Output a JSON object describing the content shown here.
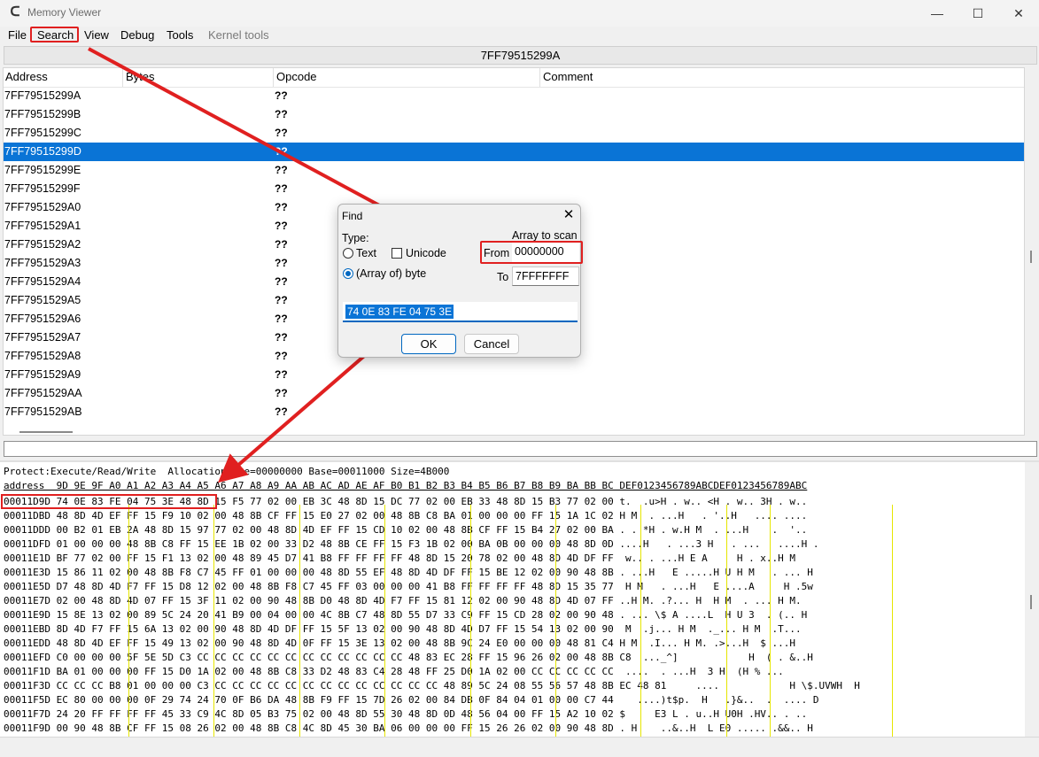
{
  "window": {
    "title": "Memory Viewer",
    "minimize": "—",
    "maximize": "☐",
    "close": "✕",
    "icon": "ce-icon"
  },
  "menu": {
    "items": [
      "File",
      "Search",
      "View",
      "Debug",
      "Tools"
    ],
    "disabled_item": "Kernel tools"
  },
  "address_bar": {
    "value": "7FF79515299A"
  },
  "disasm": {
    "columns": [
      "Address",
      "Bytes",
      "Opcode",
      "Comment"
    ],
    "rows": [
      {
        "address": "7FF79515299A",
        "opcode": "??"
      },
      {
        "address": "7FF79515299B",
        "opcode": "??"
      },
      {
        "address": "7FF79515299C",
        "opcode": "??"
      },
      {
        "address": "7FF79515299D",
        "opcode": "??"
      },
      {
        "address": "7FF79515299E",
        "opcode": "??"
      },
      {
        "address": "7FF79515299F",
        "opcode": "??"
      },
      {
        "address": "7FF7951529A0",
        "opcode": "??"
      },
      {
        "address": "7FF7951529A1",
        "opcode": "??"
      },
      {
        "address": "7FF7951529A2",
        "opcode": "??"
      },
      {
        "address": "7FF7951529A3",
        "opcode": "??"
      },
      {
        "address": "7FF7951529A4",
        "opcode": "??"
      },
      {
        "address": "7FF7951529A5",
        "opcode": "??"
      },
      {
        "address": "7FF7951529A6",
        "opcode": "??"
      },
      {
        "address": "7FF7951529A7",
        "opcode": "??"
      },
      {
        "address": "7FF7951529A8",
        "opcode": "??"
      },
      {
        "address": "7FF7951529A9",
        "opcode": "??"
      },
      {
        "address": "7FF7951529AA",
        "opcode": "??"
      },
      {
        "address": "7FF7951529AB",
        "opcode": "??"
      }
    ],
    "selected_index": 3
  },
  "hex": {
    "info": "Protect:Execute/Read/Write  AllocationBase=00000000 Base=00011000 Size=4B000",
    "header": "address  9D 9E 9F A0 A1 A2 A3 A4 A5 A6 A7 A8 A9 AA AB AC AD AE AF B0 B1 B2 B3 B4 B5 B6 B7 B8 B9 BA BB BC DEF0123456789ABCDEF0123456789ABC",
    "lines": [
      "00011D9D 74 0E 83 FE 04 75 3E 48 8D 15 F5 77 02 00 EB 3C 48 8D 15 DC 77 02 00 EB 33 48 8D 15 B3 77 02 00 t.  .u>H . w.. <H . w.. 3H . w..",
      "00011DBD 48 8D 4D EF FF 15 F9 10 02 00 48 8B CF FF 15 E0 27 02 00 48 8B C8 BA 01 00 00 00 FF 15 1A 1C 02 H M  . ...H   . '..H   .... ....",
      "00011DDD 00 B2 01 EB 2A 48 8D 15 97 77 02 00 48 8D 4D EF FF 15 CD 10 02 00 48 8B CF FF 15 B4 27 02 00 BA . . *H . w.H M  . ...H    .  '..",
      "00011DFD 01 00 00 00 48 8B C8 FF 15 EE 1B 02 00 33 D2 48 8B CE FF 15 F3 1B 02 00 BA 0B 00 00 00 48 8D 0D ....H   . ...3 H   . ...   ....H .",
      "00011E1D BF 77 02 00 FF 15 F1 13 02 00 48 89 45 D7 41 B8 FF FF FF FF 48 8D 15 20 78 02 00 48 8D 4D DF FF  w.. . ...H E A     H . x..H M",
      "00011E3D 15 86 11 02 00 48 8B F8 C7 45 FF 01 00 00 00 48 8D 55 EF 48 8D 4D DF FF 15 BE 12 02 00 90 48 8B . ...H   E .....H U H M   . ... H",
      "00011E5D D7 48 8D 4D F7 FF 15 D8 12 02 00 48 8B F8 C7 45 FF 03 00 00 00 41 B8 FF FF FF FF 48 8D 15 35 77  H M   . ...H   E ....A     H .5w",
      "00011E7D 02 00 48 8D 4D 07 FF 15 3F 11 02 00 90 48 8B D0 48 8D 4D F7 FF 15 81 12 02 00 90 48 8D 4D 07 FF ..H M. .?... H  H M  . ... H M.",
      "00011E9D 15 8E 13 02 00 89 5C 24 20 41 B9 00 04 00 00 4C 8B C7 48 8D 55 D7 33 C9 FF 15 CD 28 02 00 90 48 . ... \\$ A ....L  H U 3  . (.. H",
      "00011EBD 8D 4D F7 FF 15 6A 13 02 00 90 48 8D 4D DF FF 15 5F 13 02 00 90 48 8D 4D D7 FF 15 54 13 02 00 90  M  .j... H M  ._... H M  .T...",
      "00011EDD 48 8D 4D EF FF 15 49 13 02 00 90 48 8D 4D 0F FF 15 3E 13 02 00 48 8B 9C 24 E0 00 00 00 48 81 C4 H M  .I... H M. .>...H  $ ...H",
      "00011EFD C0 00 00 00 5F 5E 5D C3 CC CC CC CC CC CC CC CC CC CC CC CC 48 83 EC 28 FF 15 96 26 02 00 48 8B C8  ..._^]            H  ( . &..H",
      "00011F1D BA 01 00 00 00 FF 15 D0 1A 02 00 48 8B C8 33 D2 48 83 C4 28 48 FF 25 D0 1A 02 00 CC CC CC CC CC  ....  . ...H  3 H  (H % ...",
      "00011F3D CC CC CC B8 01 00 00 00 C3 CC CC CC CC CC CC CC CC CC CC CC CC CC 48 89 5C 24 08 55 56 57 48 8B EC 48 81     ....            H \\$.UVWH  H",
      "00011F5D EC 80 00 00 00 0F 29 74 24 70 0F B6 DA 48 8B F9 FF 15 7D 26 02 00 84 DB 0F 84 04 01 00 00 C7 44    ....)t$p.  H   .}&..  .  .... D",
      "00011F7D 24 20 FF FF FF FF 45 33 C9 4C 8D 05 B3 75 02 00 48 8D 55 30 48 8D 0D 48 56 04 00 FF 15 A2 10 02 $     E3 L . u..H U0H .HV.. . ..",
      "00011F9D 00 90 48 8B CF FF 15 08 26 02 00 48 8B C8 4C 8D 45 30 BA 06 00 00 00 FF 15 26 26 02 00 90 48 8D . H    ..&..H  L E0 ..... .&&.. H"
    ]
  },
  "find_dialog": {
    "title": "Find",
    "close": "✕",
    "type_label": "Type:",
    "text_option": "Text",
    "unicode_option": "Unicode",
    "array_option": "(Array of) byte",
    "array_to_scan_label": "Array to scan",
    "from_label": "From",
    "from_value": "00000000",
    "to_label": "To",
    "to_value": "7FFFFFFF",
    "bytes_value": "74 0E  83 FE 04  75 3E",
    "ok_label": "OK",
    "cancel_label": "Cancel"
  },
  "colors": {
    "accent": "#0a74d6",
    "annotation": "#e02020"
  }
}
